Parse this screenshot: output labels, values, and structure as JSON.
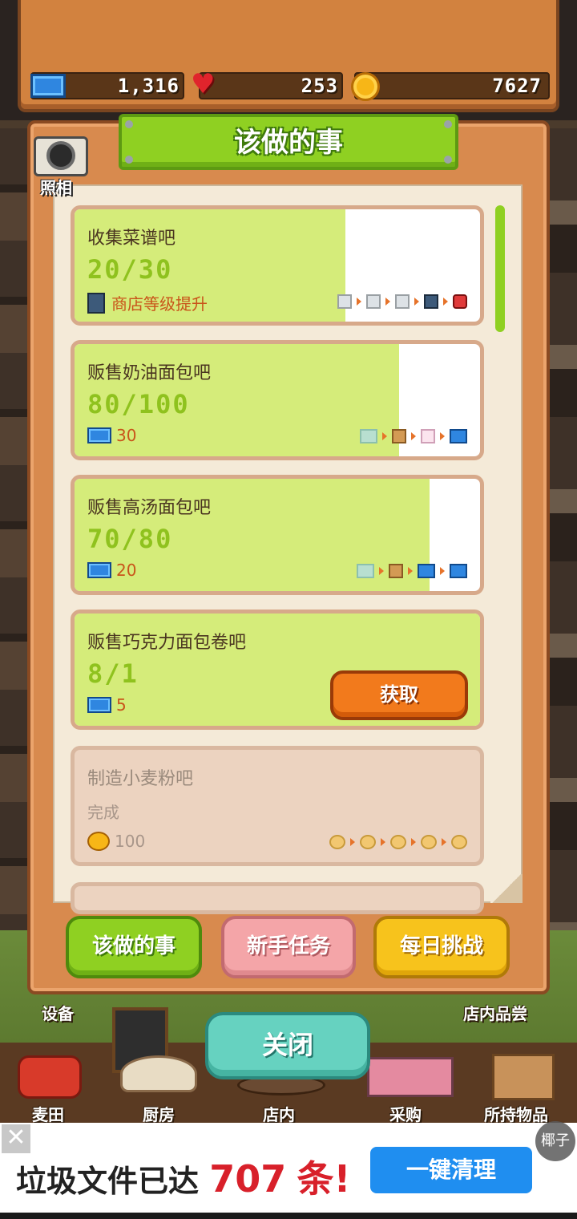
{
  "resources": {
    "tickets": "1,316",
    "hearts": "253",
    "coins": "7627"
  },
  "dialog": {
    "title": "该做的事",
    "camera_label": "照相"
  },
  "tasks": [
    {
      "title": "收集菜谱吧",
      "progress": "20/30",
      "progress_fraction": 0.667,
      "reward_text": "商店等级提升",
      "reward_icon": "shop-icon",
      "stages": [
        "locked-shop",
        "locked-shop",
        "locked-shop",
        "shop",
        "gift"
      ]
    },
    {
      "title": "贩售奶油面包吧",
      "progress": "80/100",
      "progress_fraction": 0.8,
      "reward_text": "30",
      "reward_icon": "ticket-icon",
      "stages": [
        "ticket-faded",
        "bread",
        "giftbox",
        "ticket"
      ]
    },
    {
      "title": "贩售高汤面包吧",
      "progress": "70/80",
      "progress_fraction": 0.875,
      "reward_text": "20",
      "reward_icon": "ticket-icon",
      "stages": [
        "ticket-faded",
        "bread",
        "ticket",
        "ticket"
      ]
    },
    {
      "title": "贩售巧克力面包卷吧",
      "progress": "8/1",
      "progress_fraction": 1.0,
      "reward_text": "5",
      "reward_icon": "ticket-icon",
      "button_label": "获取"
    },
    {
      "title": "制造小麦粉吧",
      "progress": "完成",
      "reward_text": "100",
      "reward_icon": "coin-icon",
      "stages": [
        "nugget",
        "nugget",
        "nugget",
        "nugget",
        "nugget"
      ]
    }
  ],
  "tabs": {
    "todo": "该做的事",
    "newbie": "新手任务",
    "daily": "每日挑战"
  },
  "scene_labels": {
    "equipment": "设备",
    "tasting": "店内品尝"
  },
  "close_label": "关闭",
  "nav": {
    "fields": "麦田",
    "kitchen": "厨房",
    "shop": "店内",
    "purchase": "采购",
    "items": "所持物品"
  },
  "ad": {
    "text_prefix": "垃圾文件已达",
    "count": "707",
    "text_suffix": "条!",
    "action": "一键清理",
    "corner": "椰子",
    "close": "✕"
  },
  "colors": {
    "progress_fill": "#d5ec7a",
    "tab_green": "#8fd022",
    "tab_pink": "#f4a5a8",
    "tab_yellow": "#f7c31c",
    "claim_orange": "#f27a1c",
    "close_teal": "#66d2c0"
  }
}
